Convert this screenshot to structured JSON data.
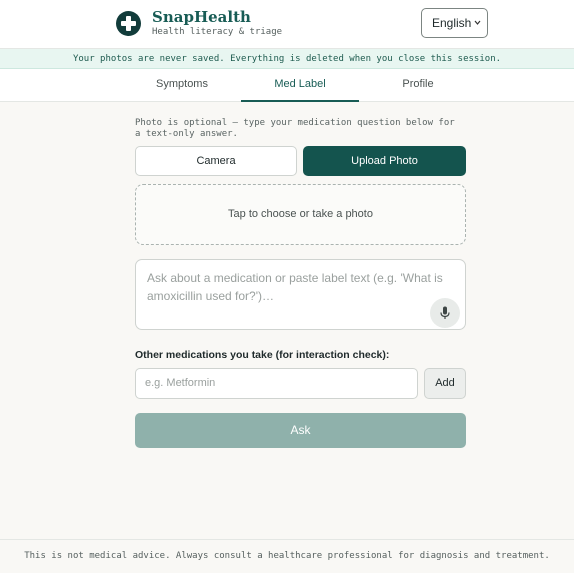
{
  "header": {
    "brand": "SnapHealth",
    "tagline": "Health literacy & triage",
    "language": "English",
    "logo_icon": "medical-cross-icon"
  },
  "banner": {
    "text": "Your photos are never saved. Everything is deleted when you close this session."
  },
  "tabs": [
    {
      "label": "Symptoms",
      "active": false
    },
    {
      "label": "Med Label",
      "active": true
    },
    {
      "label": "Profile",
      "active": false
    }
  ],
  "med_label": {
    "hint": "Photo is optional — type your medication question below for a text-only answer.",
    "camera_label": "Camera",
    "upload_label": "Upload Photo",
    "dropzone_text": "Tap to choose or take a photo",
    "question_placeholder": "Ask about a medication or paste label text (e.g. 'What is amoxicillin used for?')…",
    "mic_icon": "microphone-icon",
    "other_meds_label": "Other medications you take (for interaction check):",
    "other_meds_placeholder": "e.g. Metformin",
    "add_label": "Add",
    "ask_label": "Ask"
  },
  "footer": {
    "disclaimer": "This is not medical advice. Always consult a healthcare professional for diagnosis and treatment."
  },
  "colors": {
    "brand": "#185c55",
    "primary_button": "#14544e",
    "disabled_button": "#8fb1ab",
    "banner_bg": "#e8f6f1"
  }
}
